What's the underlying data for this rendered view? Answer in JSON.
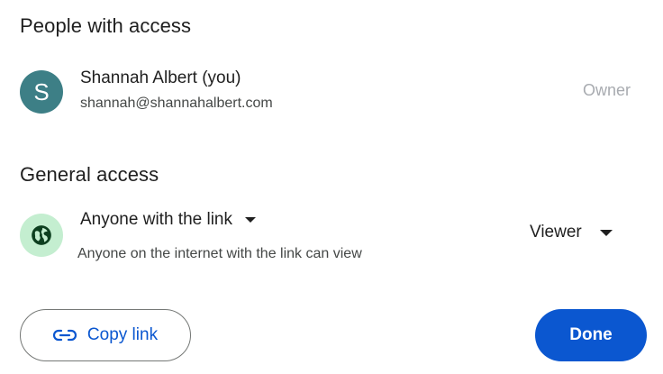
{
  "people_section": {
    "title": "People with access",
    "person": {
      "avatar_initial": "S",
      "avatar_color": "#3d7f86",
      "name": "Shannah Albert (you)",
      "email": "shannah@shannahalbert.com",
      "role": "Owner"
    }
  },
  "general_section": {
    "title": "General access",
    "icon": "globe-icon",
    "icon_bg_color": "#c4eed0",
    "access_level": "Anyone with the link",
    "description": "Anyone on the internet with the link can view",
    "role": "Viewer"
  },
  "actions": {
    "copy_link_icon": "link-icon",
    "copy_link_label": "Copy link",
    "done_label": "Done",
    "accent_color": "#0b57d0"
  }
}
